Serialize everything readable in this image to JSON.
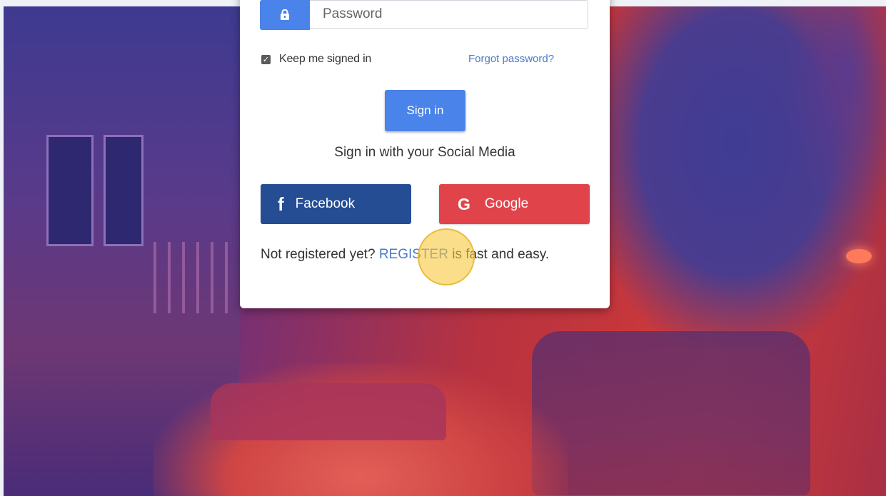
{
  "login": {
    "password_placeholder": "Password",
    "keep_signed_in_label": "Keep me signed in",
    "keep_signed_in_checked": true,
    "forgot_password": "Forgot password?",
    "signin_button": "Sign in",
    "social_title": "Sign in with your Social Media",
    "facebook_label": "Facebook",
    "facebook_icon": "f",
    "google_label": "Google",
    "google_icon": "G",
    "register_prefix": "Not registered yet? ",
    "register_link": "REGISTER",
    "register_suffix": " is fast and easy."
  },
  "icons": {
    "lock": "lock-icon",
    "check": "✓"
  },
  "colors": {
    "primary": "#4a83ea",
    "facebook": "#244d94",
    "google": "#e0444a",
    "link": "#4a7bcc",
    "highlight": "#f6c83c"
  }
}
